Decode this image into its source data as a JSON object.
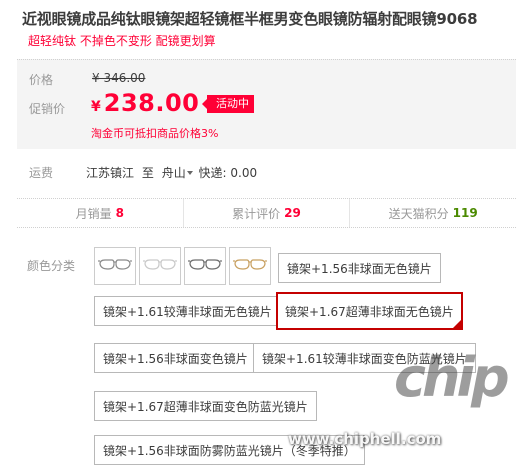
{
  "product": {
    "title": "近视眼镜成品纯钛眼镜架超轻镜框半框男变色眼镜防辐射配眼镜9068",
    "subtitle": "超轻纯钛 不掉色不变形 配镜更划算"
  },
  "price": {
    "original_label": "价格",
    "original_value": "¥ 346.00",
    "promo_label": "促销价",
    "currency": "¥",
    "promo_value": "238.00",
    "badge": "活动中",
    "tmall_note": "淘金币可抵扣商品价格3%"
  },
  "shipping": {
    "label": "运费",
    "from": "江苏镇江",
    "to_word": "至",
    "to_city": "舟山",
    "express": "快递: 0.00"
  },
  "stats": [
    {
      "label": "月销量",
      "value": "8",
      "color": "#ff0036"
    },
    {
      "label": "累计评价",
      "value": "29",
      "color": "#ff0036"
    },
    {
      "label": "送天猫积分",
      "value": "119",
      "color": "#4b8a00"
    }
  ],
  "color_options": {
    "label": "颜色分类",
    "swatches": [
      {
        "name": "frame-gray",
        "color": "#8a8a8a"
      },
      {
        "name": "frame-silver",
        "color": "#c9c9c9"
      },
      {
        "name": "frame-gunmetal",
        "color": "#6e6e6e"
      },
      {
        "name": "frame-gold",
        "color": "#c8a060"
      }
    ],
    "items": [
      {
        "label": "镜架+1.56非球面无色镜片",
        "selected": false
      },
      {
        "label": "镜架+1.61较薄非球面无色镜片",
        "selected": false
      },
      {
        "label": "镜架+1.67超薄非球面无色镜片",
        "selected": true
      },
      {
        "label": "镜架+1.56非球面变色镜片",
        "selected": false
      },
      {
        "label": "镜架+1.61较薄非球面变色防蓝光镜片",
        "selected": false
      },
      {
        "label": "镜架+1.67超薄非球面变色防蓝光镜片",
        "selected": false
      },
      {
        "label": "镜架+1.56非球面防雾防蓝光镜片（冬季特推）",
        "selected": false
      }
    ]
  },
  "watermark": {
    "logo": "chip",
    "url": "www.chiphell.com"
  },
  "theme": {
    "accent": "#ff0036",
    "selected_border": "#c40000"
  }
}
